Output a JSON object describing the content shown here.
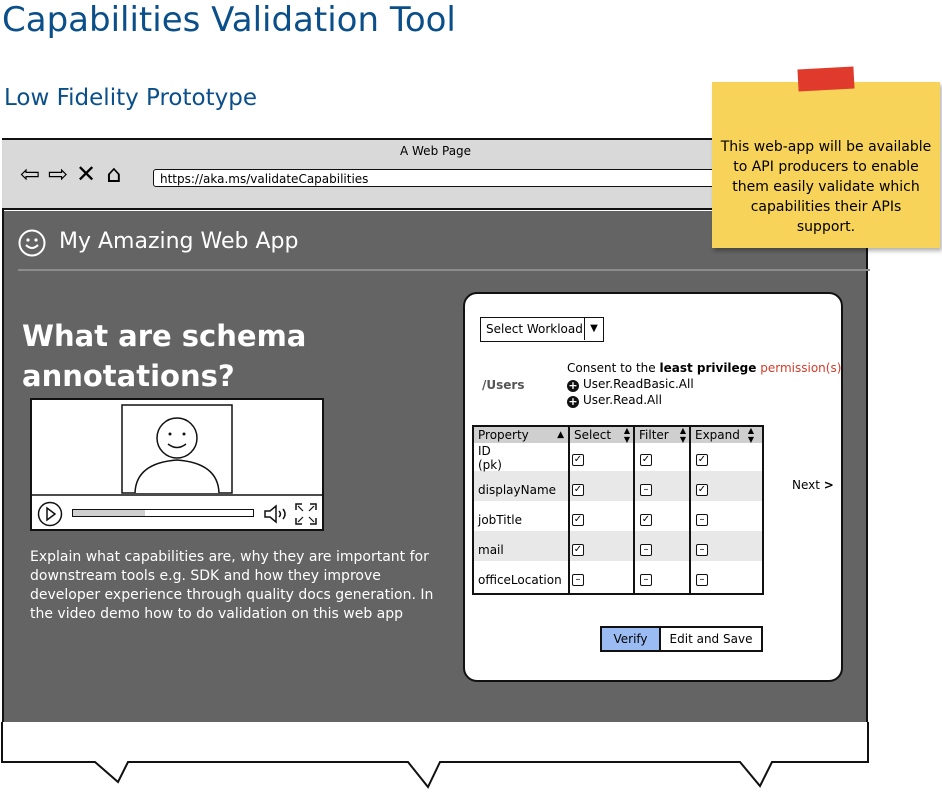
{
  "doc": {
    "title": "Capabilities Validation Tool",
    "subtitle": "Low Fidelity Prototype"
  },
  "browser": {
    "page_title": "A Web Page",
    "url": "https://aka.ms/validateCapabilities",
    "nav": {
      "back": "⇦",
      "forward": "⇨",
      "stop": "✕",
      "home": "⌂"
    }
  },
  "app": {
    "name": "My Amazing Web App",
    "hero_title": "What are schema annotations?",
    "description": "Explain what capabilities are, why they are important for downstream tools e.g. SDK and how they improve developer experience through quality docs generation. In the video demo how to do validation on this web app",
    "video_progress": 0.4
  },
  "panel": {
    "workload_select": "Select Workload",
    "endpoint": "/Users",
    "consent_prefix": "Consent to the ",
    "consent_bold": "least privilege",
    "consent_link": "permission(s)",
    "permissions": [
      "User.ReadBasic.All",
      "User.Read.All"
    ],
    "columns": [
      "Property",
      "Select",
      "Filter",
      "Expand"
    ],
    "rows": [
      {
        "property": "ID\n(pk)",
        "select": true,
        "filter": true,
        "expand": true
      },
      {
        "property": "displayName",
        "select": true,
        "filter": false,
        "expand": true
      },
      {
        "property": "jobTitle",
        "select": true,
        "filter": true,
        "expand": false
      },
      {
        "property": "mail",
        "select": true,
        "filter": false,
        "expand": false
      },
      {
        "property": "officeLocation",
        "select": false,
        "filter": false,
        "expand": false
      }
    ],
    "next_label": "Next",
    "verify_label": "Verify",
    "edit_save_label": "Edit and Save"
  },
  "sticky_note": {
    "text": "This web-app will be available to API producers to enable them easily validate which capabilities their APIs support."
  },
  "colors": {
    "title_blue": "#0b4f8a",
    "app_bg": "#646464",
    "sticky": "#f8d35a",
    "verify_bg": "#9bbcf3",
    "permission_red": "#d43b2a"
  }
}
